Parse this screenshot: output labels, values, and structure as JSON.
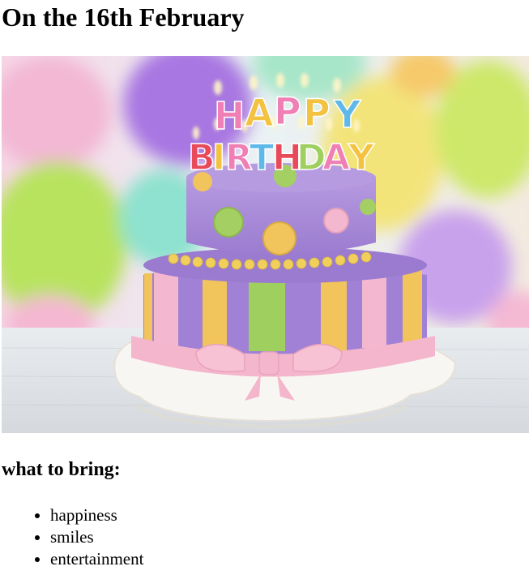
{
  "heading": "On the 16th February",
  "image": {
    "cake_lettering": "HAPPY BIRTHDAY"
  },
  "bring": {
    "title": "what to bring:",
    "items": [
      "happiness",
      "smiles",
      "entertainment"
    ]
  }
}
